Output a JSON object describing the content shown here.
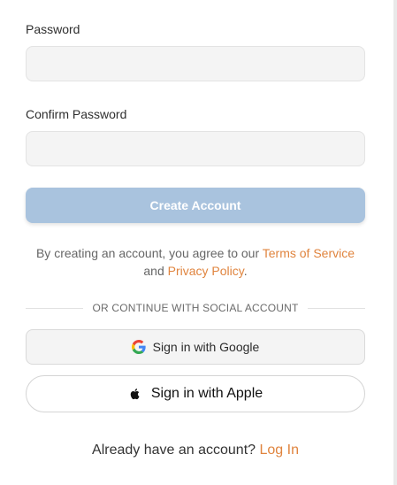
{
  "password": {
    "label": "Password",
    "value": "",
    "placeholder": ""
  },
  "confirm_password": {
    "label": "Confirm Password",
    "value": "",
    "placeholder": ""
  },
  "create_account": {
    "label": "Create Account",
    "color": "#a9c3de"
  },
  "terms": {
    "prefix": "By creating an account, you agree to our ",
    "terms_link": "Terms of Service",
    "middle": " and ",
    "privacy_link": "Privacy Policy",
    "suffix": ".",
    "link_color": "#e0843e"
  },
  "divider": {
    "text": "OR CONTINUE WITH SOCIAL ACCOUNT"
  },
  "social": {
    "google": {
      "label": "Sign in with Google",
      "icon": "google-icon"
    },
    "apple": {
      "label": "Sign in with Apple",
      "icon": "apple-icon"
    }
  },
  "login": {
    "prompt": "Already have an account? ",
    "link": "Log In"
  }
}
